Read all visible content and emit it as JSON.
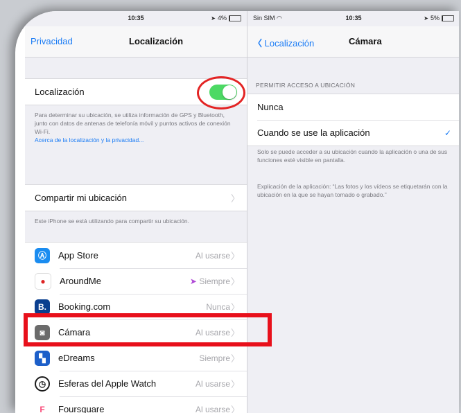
{
  "left": {
    "status": {
      "time": "10:35",
      "battery": "4%"
    },
    "nav": {
      "back": "Privacidad",
      "title": "Localización"
    },
    "location_row": {
      "label": "Localización",
      "enabled": true
    },
    "location_note": "Para determinar su ubicación, se utiliza información de GPS y Bluetooth, junto con datos de antenas de telefonía móvil y puntos activos de conexión Wi-Fi.",
    "location_link": "Acerca de la localización y la privacidad...",
    "share": {
      "label": "Compartir mi ubicación"
    },
    "share_note": "Este iPhone se está utilizando para compartir su ubicación.",
    "apps": [
      {
        "name": "App Store",
        "value": "Al usarse",
        "icon": "app-store-icon",
        "color": "#1a8cf0"
      },
      {
        "name": "AroundMe",
        "value": "Siempre",
        "icon": "aroundme-icon",
        "color": "#ffffff"
      },
      {
        "name": "Booking.com",
        "value": "Nunca",
        "icon": "booking-icon",
        "color": "#0a3f8f"
      },
      {
        "name": "Cámara",
        "value": "Al usarse",
        "icon": "camera-icon",
        "color": "#6b6b6b"
      },
      {
        "name": "eDreams",
        "value": "Siempre",
        "icon": "edreams-icon",
        "color": "#1c5fc9"
      },
      {
        "name": "Esferas del Apple Watch",
        "value": "Al usarse",
        "icon": "watch-icon",
        "color": "#1a1a1a"
      },
      {
        "name": "Foursquare",
        "value": "Al usarse",
        "icon": "foursquare-icon",
        "color": "#ffffff"
      }
    ]
  },
  "right": {
    "status": {
      "carrier": "Sin SIM",
      "time": "10:35",
      "battery": "5%"
    },
    "nav": {
      "back": "Localización",
      "title": "Cámara"
    },
    "section_header": "PERMITIR ACCESO A UBICACIÓN",
    "options": [
      {
        "label": "Nunca",
        "selected": false
      },
      {
        "label": "Cuando se use la aplicación",
        "selected": true
      }
    ],
    "note1": "Solo se puede acceder a su ubicación cuando la aplicación o una de sus funciones esté visible en pantalla.",
    "note2": "Explicación de la aplicación: “Las fotos y los vídeos se etiquetarán con la ubicación en la que se hayan tomado o grabado.”"
  },
  "colors": {
    "accent": "#1b7cf5",
    "toggle_on": "#4cd964",
    "highlight": "#e8101b"
  }
}
